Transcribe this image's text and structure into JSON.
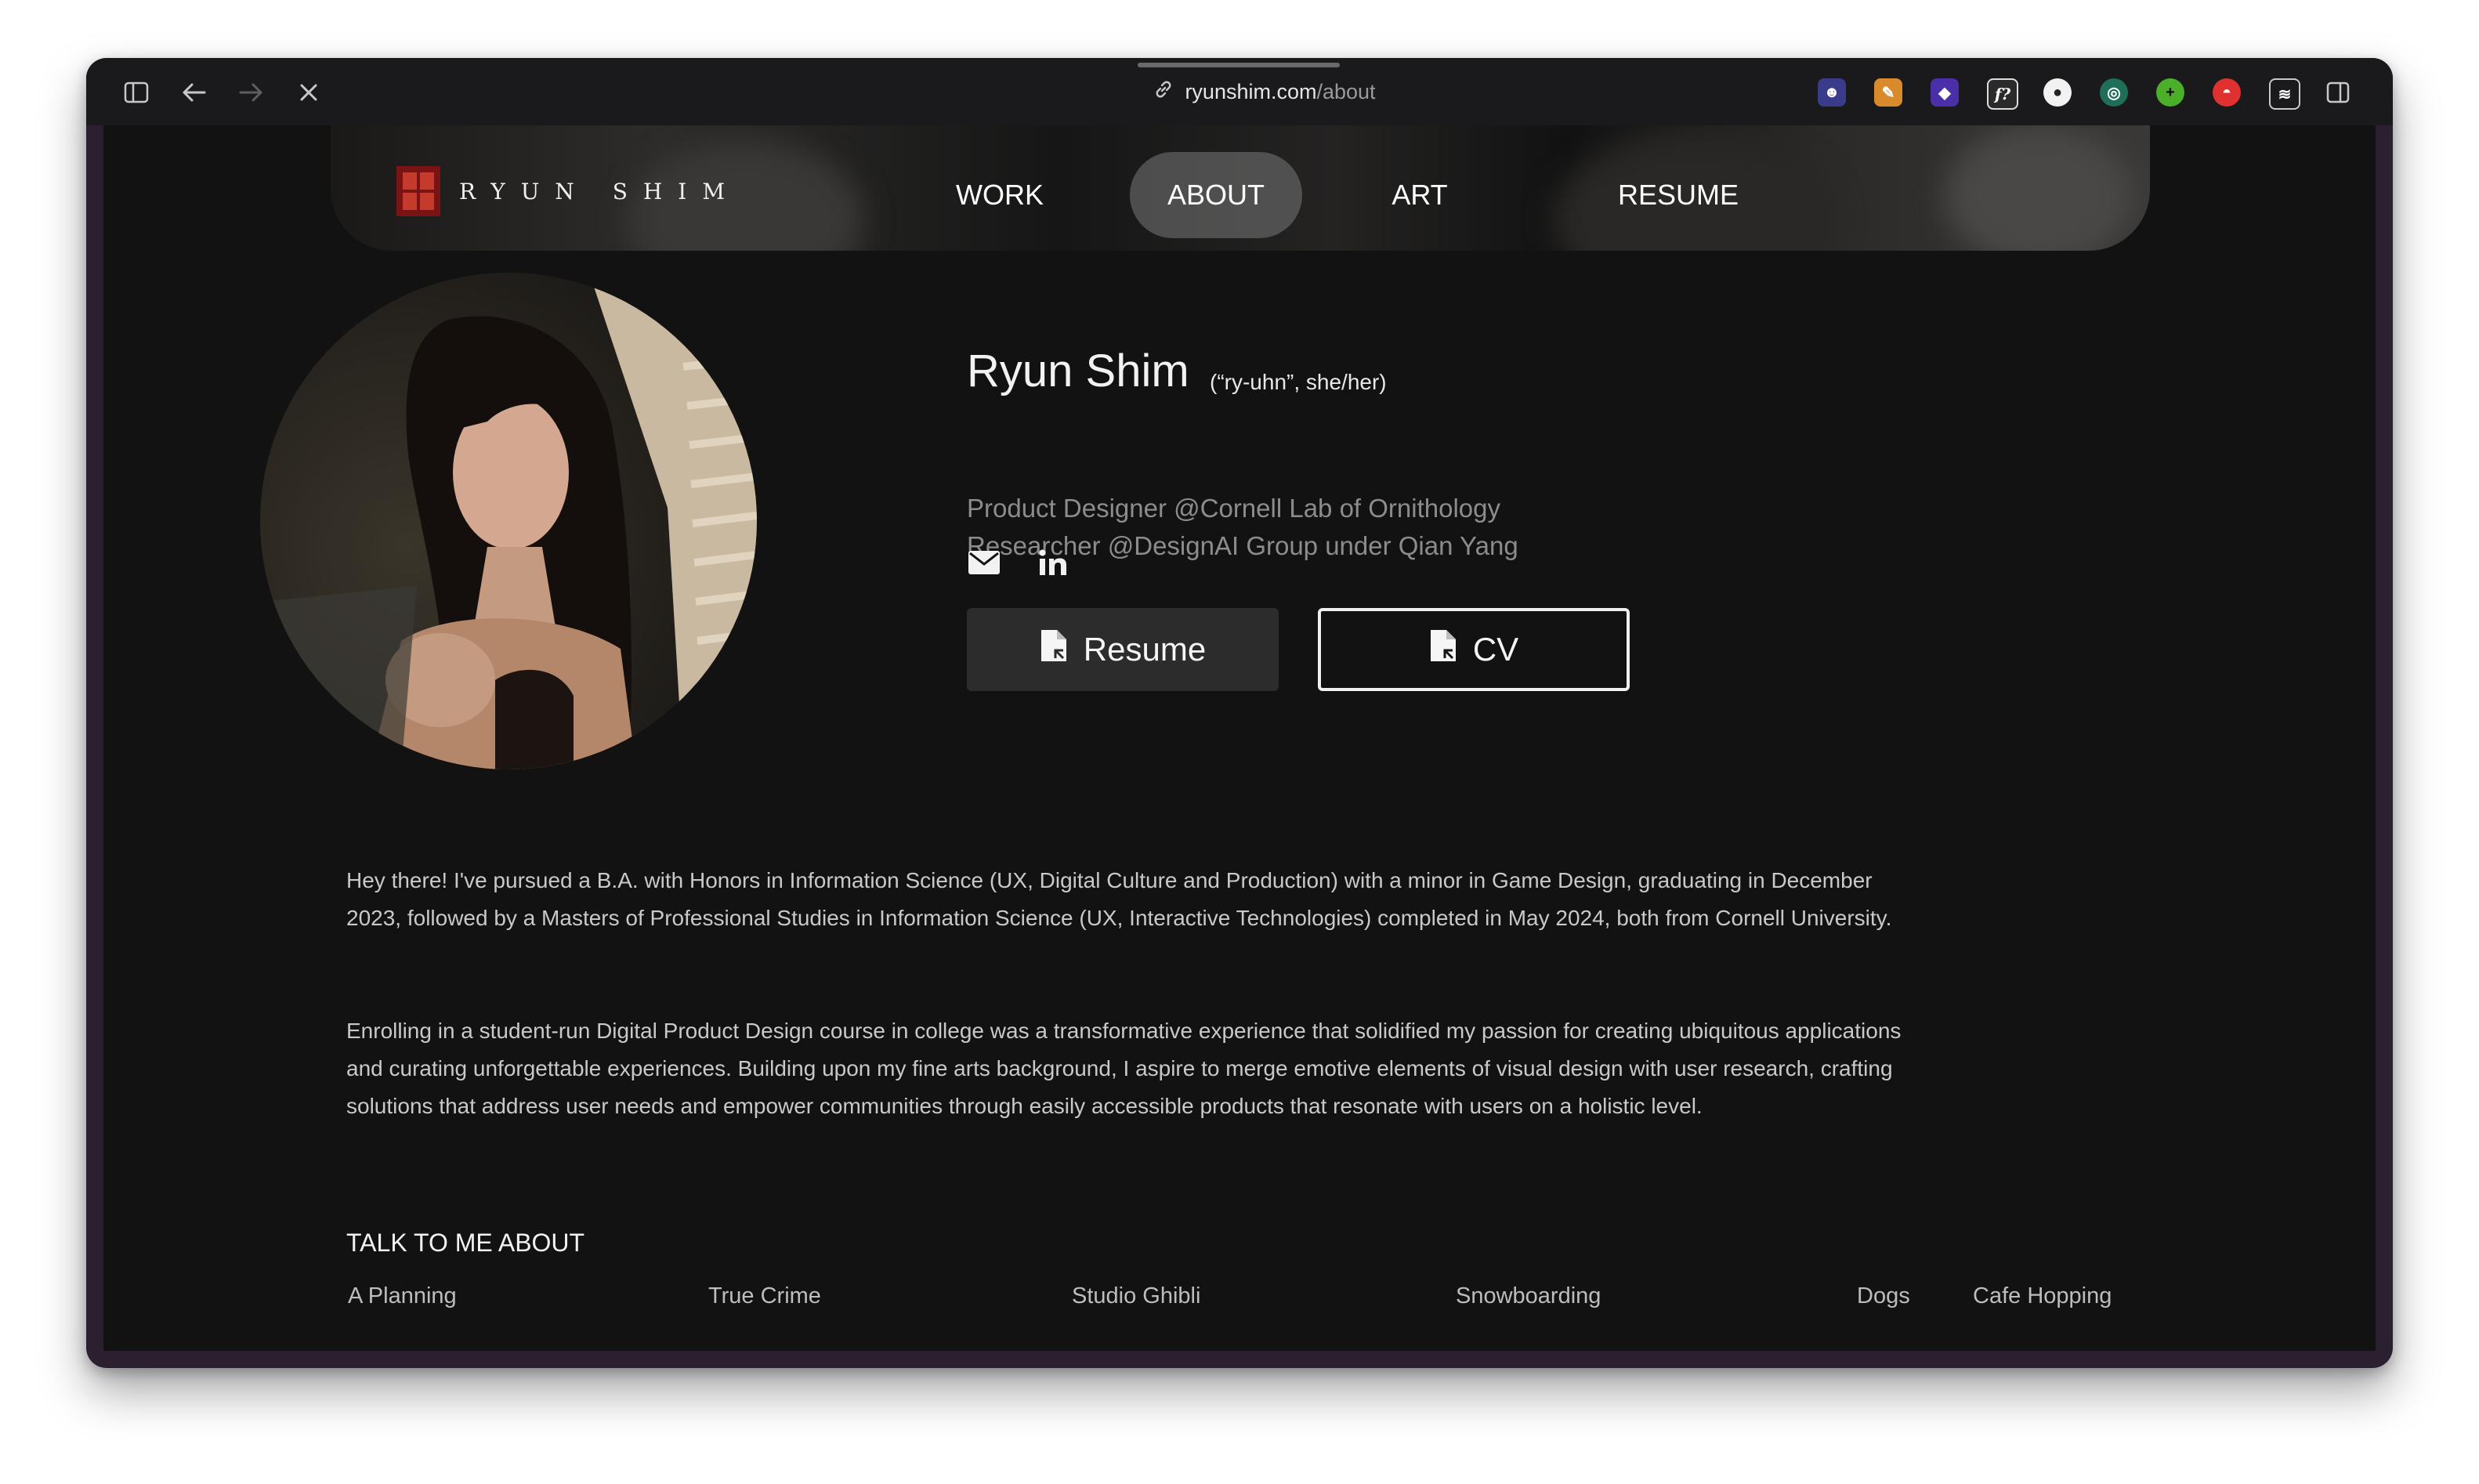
{
  "browser": {
    "url_domain": "ryunshim.com",
    "url_path": "/about"
  },
  "site": {
    "logo_text": "RYUN SHIM",
    "nav": [
      {
        "label": "WORK"
      },
      {
        "label": "ABOUT"
      },
      {
        "label": "ART"
      },
      {
        "label": "RESUME"
      }
    ],
    "active_nav": "ABOUT"
  },
  "profile": {
    "name": "Ryun Shim",
    "pronunciation": "(“ry-uhn”, she/her)",
    "roles": [
      "Product Designer @Cornell Lab of Ornithology",
      "Researcher @DesignAI Group under Qian Yang"
    ],
    "social_icons": [
      "email-icon",
      "linkedin-icon"
    ],
    "buttons": {
      "resume": "Resume",
      "cv": "CV"
    }
  },
  "about": {
    "paragraphs": [
      "Hey there! I've pursued a B.A. with Honors in Information Science (UX, Digital Culture and Production) with a minor in Game Design, graduating in December 2023, followed by a Masters of Professional Studies in Information Science (UX, Interactive Technologies) completed in May 2024, both from Cornell University.",
      "Enrolling in a student-run Digital Product Design course in college was a transformative experience that solidified my passion for creating ubiquitous applications and curating unforgettable experiences. Building upon my fine arts background, I aspire to merge emotive elements of visual design with user research, crafting solutions that address user needs and empower communities through easily accessible products that resonate with users on a holistic level."
    ]
  },
  "talk": {
    "heading": "TALK TO ME ABOUT",
    "topics": [
      "A Planning",
      "True Crime",
      "Studio Ghibli",
      "Snowboarding",
      "Dogs",
      "Cafe Hopping"
    ]
  },
  "colors": {
    "page_bg": "#121212",
    "accent_logo": "#7a1414",
    "muted_text": "#8c8c8c"
  }
}
